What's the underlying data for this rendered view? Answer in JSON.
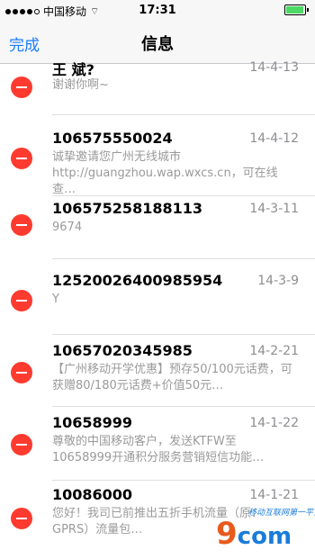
{
  "status": {
    "carrier": "中国移动",
    "time": "17:31"
  },
  "nav": {
    "done_label": "完成",
    "title": "信息"
  },
  "messages": [
    {
      "name": "王 斌?",
      "date": "14-4-13",
      "preview": "谢谢你啊~"
    },
    {
      "name": "106575550024",
      "date": "14-4-12",
      "preview": "诚挚邀请您广州无线城市http://guangzhou.wap.wxcs.cn，可在线查…"
    },
    {
      "name": "106575258188113",
      "date": "14-3-11",
      "preview": "9674"
    },
    {
      "name": "12520026400985954",
      "date": "14-3-9",
      "preview": "Y"
    },
    {
      "name": "10657020345985",
      "date": "14-2-21",
      "preview": "【广州移动开学优惠】预存50/100元话费，可获赠80/180元话费+价值50元…"
    },
    {
      "name": "10658999",
      "date": "14-1-22",
      "preview": "尊敬的中国移动客户，发送KTFW至10658999开通积分服务营销短信功能…"
    },
    {
      "name": "10086000",
      "date": "14-1-21",
      "preview": "您好！我司已前推出五折手机流量（原：GPRS）流量包…"
    }
  ],
  "watermark": {
    "tagline": "移动互联网第一平台",
    "brand_num": "9",
    "brand_text": "com"
  },
  "colors": {
    "accent": "#1a7cff",
    "delete": "#ff3b30"
  }
}
